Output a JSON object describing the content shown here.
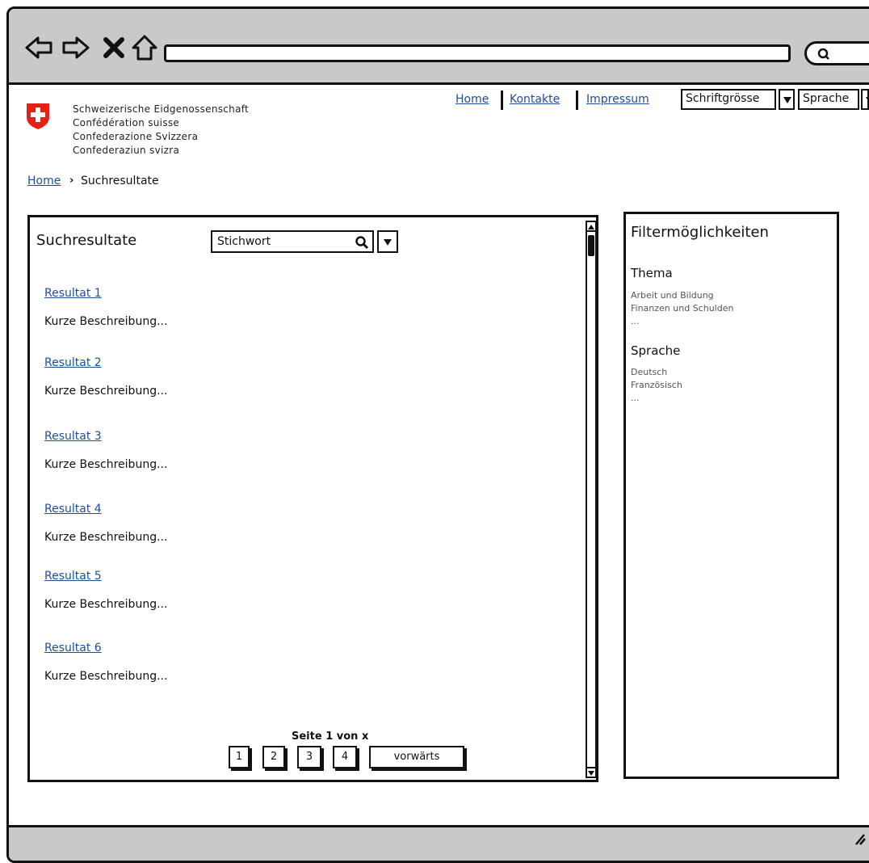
{
  "browser": {
    "nav_icons": [
      "back-arrow-icon",
      "forward-arrow-icon",
      "stop-icon",
      "home-icon"
    ],
    "address_value": "",
    "search_icon": "search-icon"
  },
  "header": {
    "federal_lines": [
      "Schweizerische Eidgenossenschaft",
      "Confédération suisse",
      "Confederazione Svizzera",
      "Confederaziun svizra"
    ],
    "links": [
      "Home",
      "Kontakte",
      "Impressum"
    ],
    "font_size_label": "Schriftgrösse",
    "language_label": "Sprache"
  },
  "breadcrumb": {
    "home": "Home",
    "separator": "›",
    "current": "Suchresultate"
  },
  "results": {
    "title": "Suchresultate",
    "keyword_placeholder": "Stichwort",
    "items": [
      {
        "link": "Resultat 1",
        "desc": "Kurze Beschreibung..."
      },
      {
        "link": "Resultat 2",
        "desc": "Kurze Beschreibung..."
      },
      {
        "link": "Resultat 3",
        "desc": "Kurze Beschreibung..."
      },
      {
        "link": "Resultat 4",
        "desc": "Kurze Beschreibung..."
      },
      {
        "link": "Resultat 5",
        "desc": "Kurze Beschreibung..."
      },
      {
        "link": "Resultat 6",
        "desc": "Kurze Beschreibung..."
      }
    ],
    "page_info": "Seite 1 von x",
    "pages": [
      "1",
      "2",
      "3",
      "4"
    ],
    "next_label": "vorwärts"
  },
  "filters": {
    "title": "Filtermöglichkeiten",
    "groups": [
      {
        "heading": "Thema",
        "items": [
          "Arbeit und Bildung",
          "Finanzen und Schulden",
          "..."
        ]
      },
      {
        "heading": "Sprache",
        "items": [
          "Deutsch",
          "Französisch",
          "..."
        ]
      }
    ]
  },
  "colors": {
    "link": "#1f4e9a",
    "chrome": "#c9c9c9",
    "flag_red": "#e32119"
  }
}
